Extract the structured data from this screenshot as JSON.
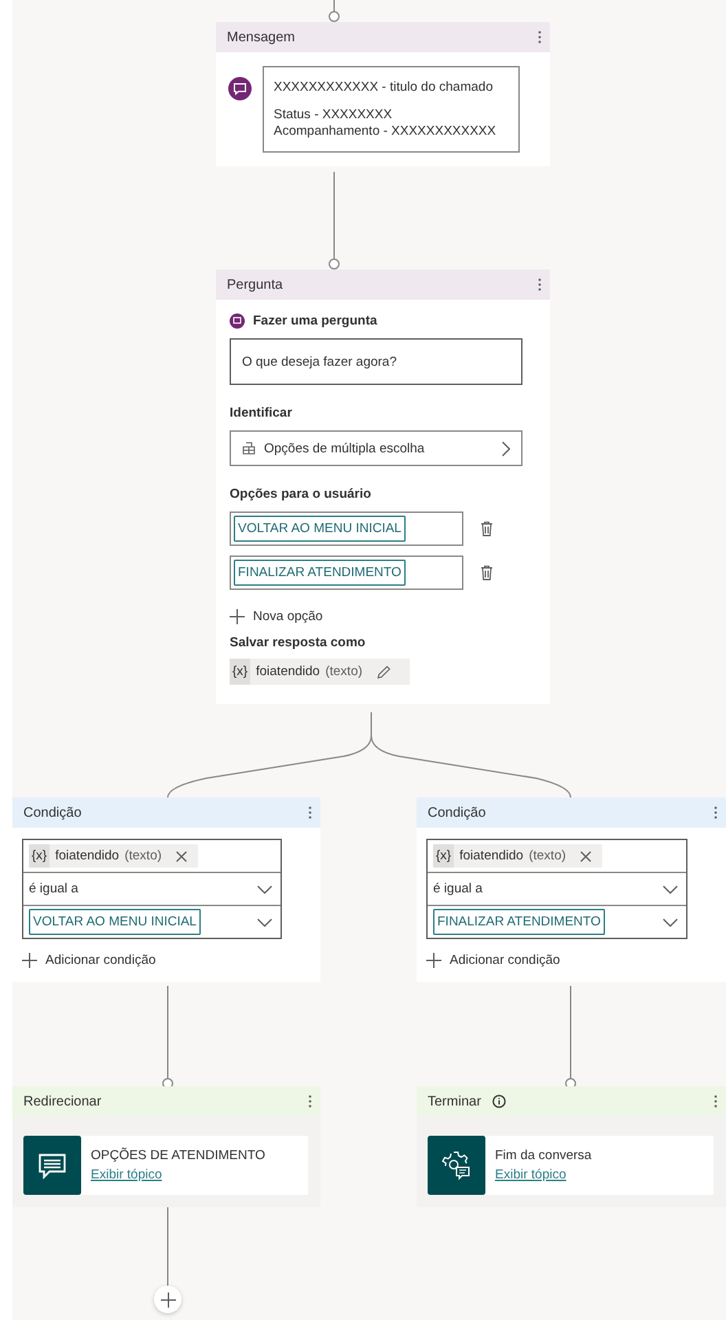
{
  "nodes": [
    {
      "kind": "message",
      "title": "Mensagem",
      "lines": [
        "XXXXXXXXXXXX - titulo do chamado",
        "Status - XXXXXXXX",
        "Acompanhamento - XXXXXXXXXXXX"
      ]
    },
    {
      "kind": "question",
      "title": "Pergunta",
      "prompt_label": "Fazer uma pergunta",
      "question": "O que deseja fazer agora?",
      "identify_label": "Identificar",
      "identify_value": "Opções de múltipla escolha",
      "options_label": "Opções para o usuário",
      "options": [
        "VOLTAR AO MENU INICIAL",
        "FINALIZAR ATENDIMENTO"
      ],
      "add_option": "Nova opção",
      "save_label": "Salvar resposta como",
      "variable": {
        "token": "{x}",
        "name": "foiatendido",
        "type": "(texto)"
      }
    },
    {
      "kind": "condition",
      "title": "Condição",
      "variable": {
        "token": "{x}",
        "name": "foiatendido",
        "type": "(texto)"
      },
      "operator": "é igual a",
      "value": "VOLTAR AO MENU INICIAL",
      "add_condition": "Adicionar condição"
    },
    {
      "kind": "condition",
      "title": "Condição",
      "variable": {
        "token": "{x}",
        "name": "foiatendido",
        "type": "(texto)"
      },
      "operator": "é igual a",
      "value": "FINALIZAR ATENDIMENTO",
      "add_condition": "Adicionar condição"
    },
    {
      "kind": "redirect",
      "title": "Redirecionar",
      "topic": "OPÇÕES DE ATENDIMENTO",
      "link": "Exibir tópico"
    },
    {
      "kind": "end",
      "title": "Terminar",
      "topic": "Fim da conversa",
      "link": "Exibir tópico"
    }
  ]
}
